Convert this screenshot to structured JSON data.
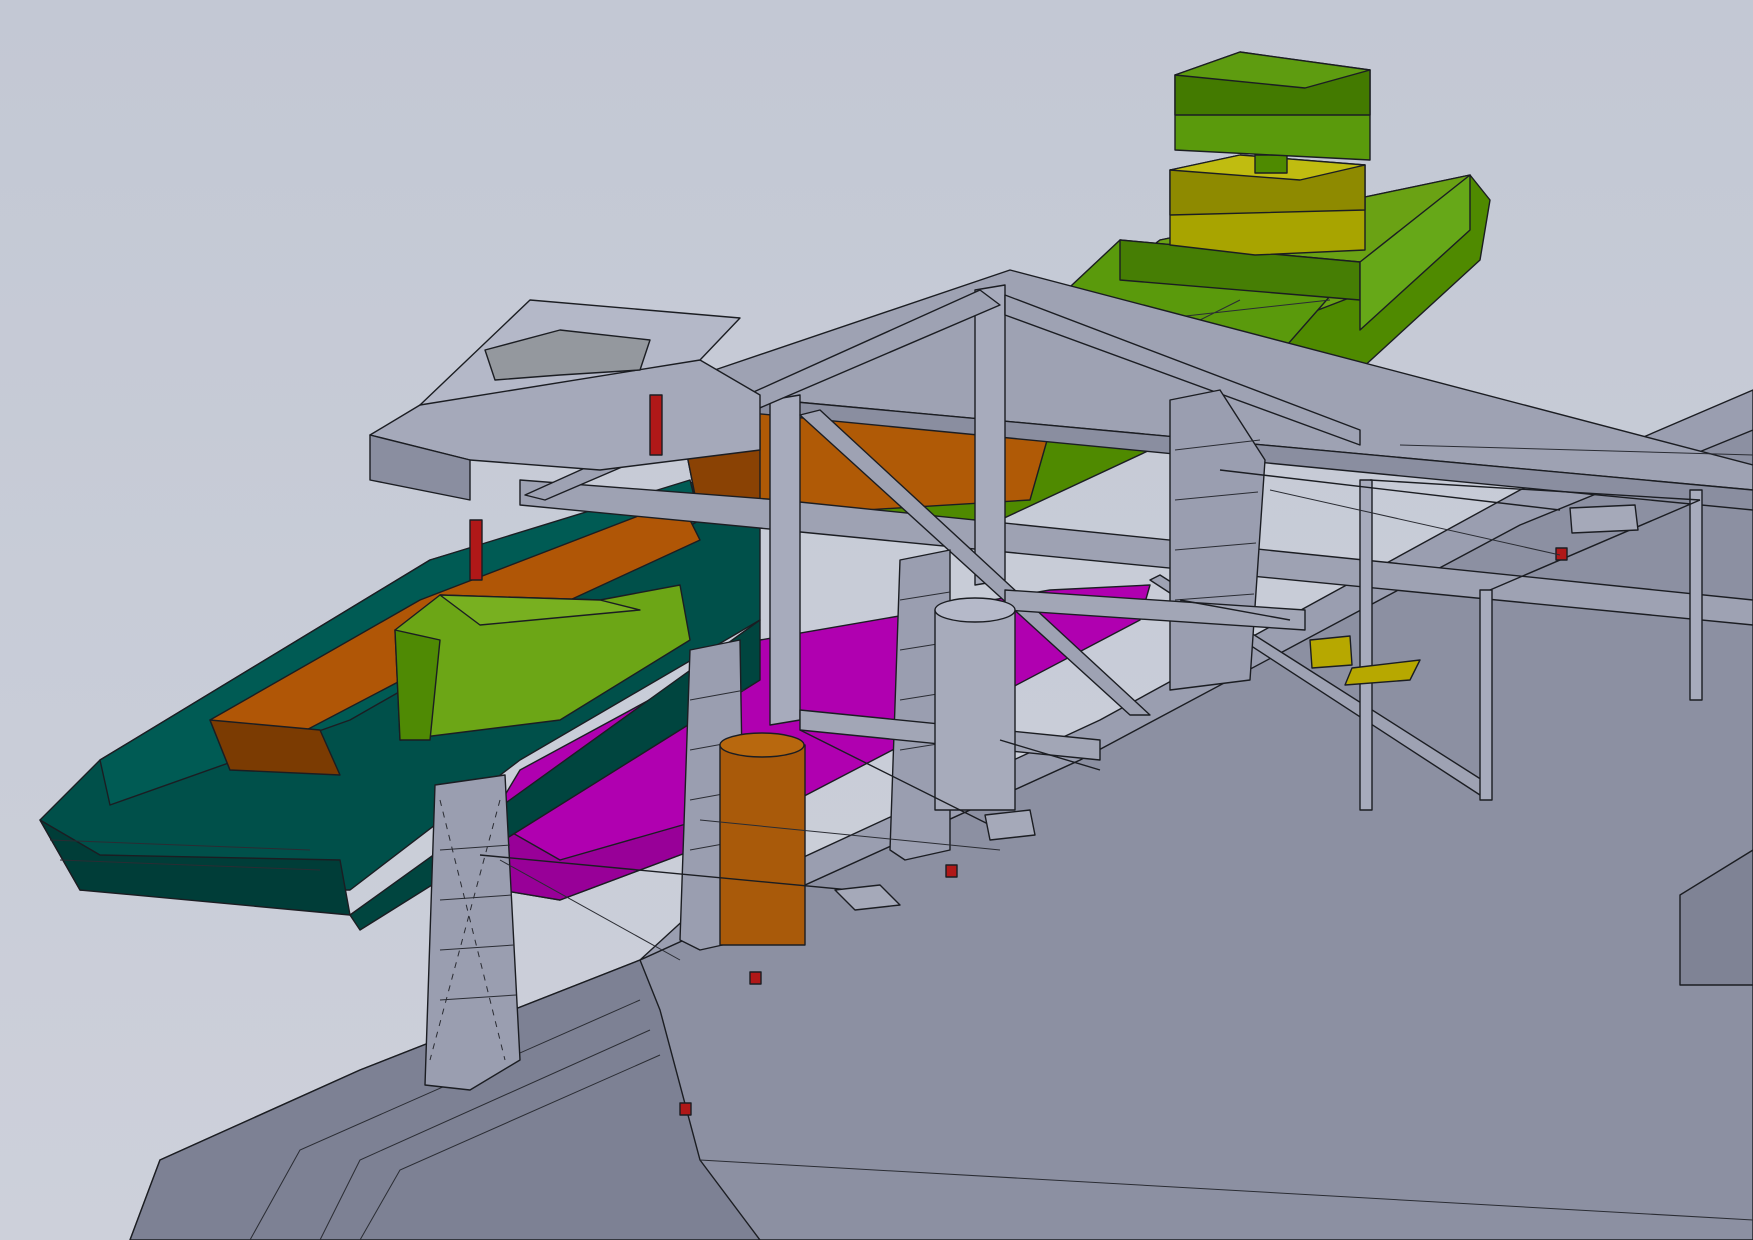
{
  "viewport": {
    "background_color": "#c6cad5",
    "render_style": "shaded-with-edges"
  },
  "colors": {
    "quay": "#8a8ea0",
    "quay_top": "#9a9eb0",
    "steel": "#9fa3b4",
    "steel_dark": "#7f8394",
    "green_vessel": "#5c9a10",
    "green_dark": "#3f6e06",
    "bright_green": "#4e8a00",
    "yellow_block": "#a8a400",
    "teal_barge": "#00504a",
    "teal_dark": "#003b37",
    "orange_hold": "#b55a06",
    "orange_dark": "#7a3a02",
    "magenta_hull": "#b400b4",
    "red_post": "#b01818"
  }
}
